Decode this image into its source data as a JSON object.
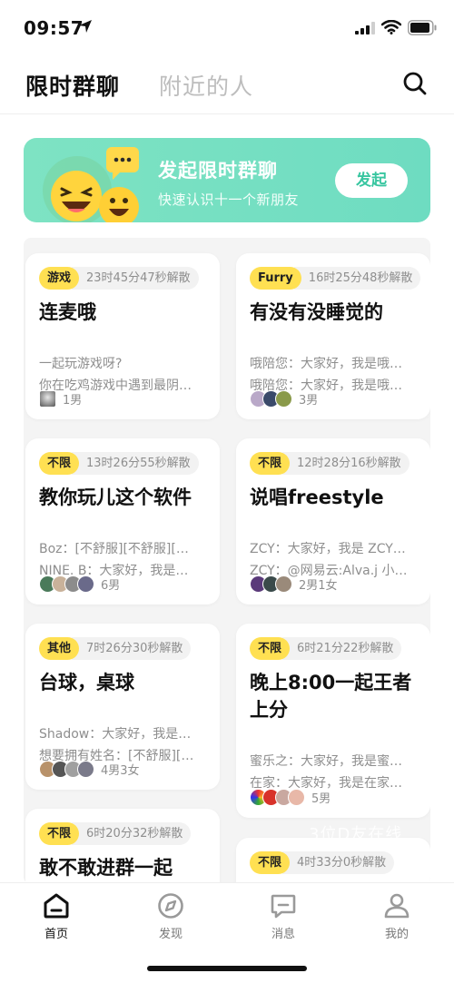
{
  "status": {
    "time": "09:57"
  },
  "topnav": {
    "tab_active": "限时群聊",
    "tab_inactive": "附近的人"
  },
  "banner": {
    "title": "发起限时群聊",
    "subtitle": "快速认识十一个新朋友",
    "button": "发起"
  },
  "cards": [
    {
      "tag": "游戏",
      "timer": "23时45分47秒解散",
      "title": "连麦哦",
      "msgs": [
        "一起玩游戏呀?",
        "你在吃鸡游戏中遇到最阴…"
      ],
      "members": "1男"
    },
    {
      "tag": "Furry",
      "timer": "16时25分48秒解散",
      "title": "有没有没睡觉的",
      "msgs": [
        "哦陪您：大家好，我是哦…",
        "哦陪您：大家好，我是哦…"
      ],
      "members": "3男"
    },
    {
      "tag": "不限",
      "timer": "13时26分55秒解散",
      "title": "教你玩儿这个软件",
      "msgs": [
        "Boz：[不舒服][不舒服][…",
        "NINE. B：大家好，我是…"
      ],
      "members": "6男"
    },
    {
      "tag": "不限",
      "timer": "12时28分16秒解散",
      "title": "说唱freestyle",
      "msgs": [
        "ZCY：大家好，我是 ZCY…",
        "ZCY：@网易云:Alva.j 小…"
      ],
      "members": "2男1女"
    },
    {
      "tag": "其他",
      "timer": "7时26分30秒解散",
      "title": "台球，桌球",
      "msgs": [
        "Shadow：大家好，我是…",
        "想要拥有姓名：[不舒服][…"
      ],
      "members": "4男3女"
    },
    {
      "tag": "不限",
      "timer": "6时21分22秒解散",
      "title": "晚上8:00一起王者上分",
      "msgs": [
        "蜜乐之：大家好，我是蜜…",
        "在家：大家好，我是在家…"
      ],
      "members": "5男"
    },
    {
      "tag": "不限",
      "timer": "6时20分32秒解散",
      "title": "敢不敢进群一起"
    },
    {
      "tag": "不限",
      "timer": "4时33分0秒解散"
    }
  ],
  "overlay": "3位D友在线",
  "bottom": {
    "home": "首页",
    "discover": "发现",
    "messages": "消息",
    "me": "我的"
  },
  "colors": {
    "accent_green": "#6edcc1",
    "tag_yellow": "#ffe052",
    "timer_gray": "#f2f2f2"
  }
}
